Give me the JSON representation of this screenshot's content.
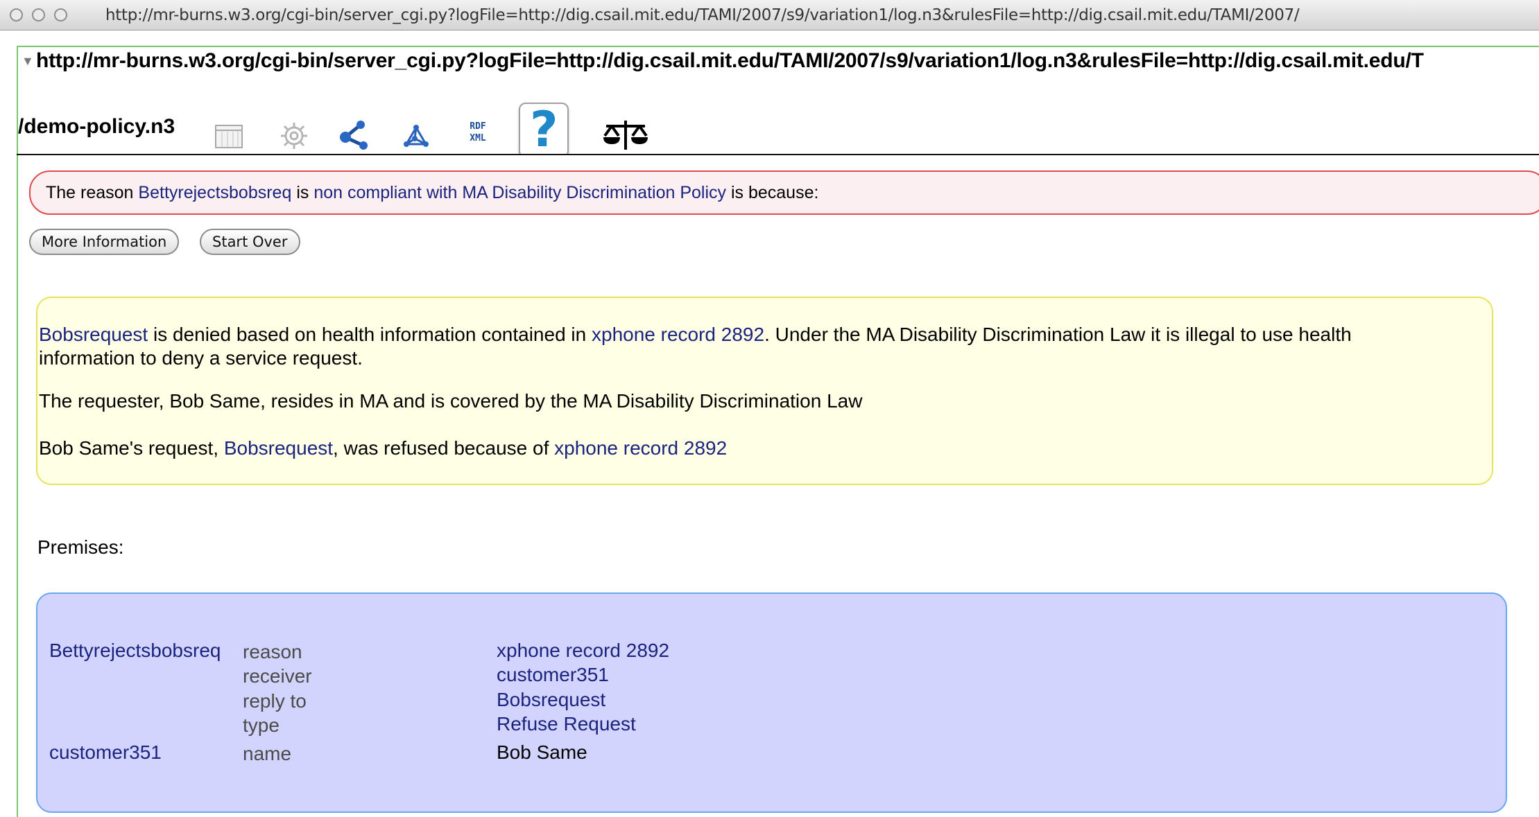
{
  "window": {
    "url": "http://mr-burns.w3.org/cgi-bin/server_cgi.py?logFile=http://dig.csail.mit.edu/TAMI/2007/s9/variation1/log.n3&rulesFile=http://dig.csail.mit.edu/TAMI/2007/"
  },
  "subject": {
    "url_line": "http://mr-burns.w3.org/cgi-bin/server_cgi.py?logFile=http://dig.csail.mit.edu/TAMI/2007/s9/variation1/log.n3&rulesFile=http://dig.csail.mit.edu/T",
    "url_tail": "/demo-policy.n3"
  },
  "toolbar": {
    "icons": [
      "table-view-icon",
      "settings-gear-icon",
      "graph-view-icon",
      "molecule-view-icon",
      "rdf-xml-icon",
      "justification-help-icon",
      "policy-scales-icon"
    ],
    "rdf_xml_label_1": "RDF",
    "rdf_xml_label_2": "XML",
    "help_glyph": "?"
  },
  "reason": {
    "prefix": "The reason",
    "subject_link": "Bettyrejectsbobsreq",
    "is": "is",
    "status_link": "non compliant with",
    "policy_link": "MA Disability Discrimination Policy",
    "suffix": "is because:"
  },
  "buttons": {
    "more_info": "More Information",
    "start_over": "Start Over"
  },
  "explanation": {
    "p1_link1": "Bobsrequest",
    "p1_text1": " is denied based on health information contained in ",
    "p1_link2": "xphone record 2892",
    "p1_text2": ". Under the MA Disability Discrimination Law it is illegal to use health",
    "p1_line2": "information to deny a service request.",
    "p2": "The requester, Bob Same, resides in MA and is covered by the MA Disability Discrimination Law",
    "p3_text1": "Bob Same's request, ",
    "p3_link1": "Bobsrequest",
    "p3_text2": ", was refused because of ",
    "p3_link2": "xphone record 2892"
  },
  "premises": {
    "label": "Premises:",
    "rows": [
      {
        "subject": "Bettyrejectsbobsreq",
        "predicate": "reason",
        "object": "xphone record 2892"
      },
      {
        "subject": "",
        "predicate": "receiver",
        "object": "customer351"
      },
      {
        "subject": "",
        "predicate": "reply to",
        "object": "Bobsrequest"
      },
      {
        "subject": "",
        "predicate": "type",
        "object": "Refuse Request"
      },
      {
        "subject": "customer351",
        "predicate": "name",
        "object": "Bob Same"
      }
    ]
  },
  "colors": {
    "link": "#1a237e",
    "pane_border": "#7ac66b",
    "reason_border": "#e04a4a",
    "reason_bg": "#fbeff2",
    "explanation_bg": "#ffffe6",
    "explanation_border": "#e8e35a",
    "premises_bg": "#d2d4fd",
    "premises_border": "#6aa6f0",
    "help_icon": "#1e88c8"
  }
}
